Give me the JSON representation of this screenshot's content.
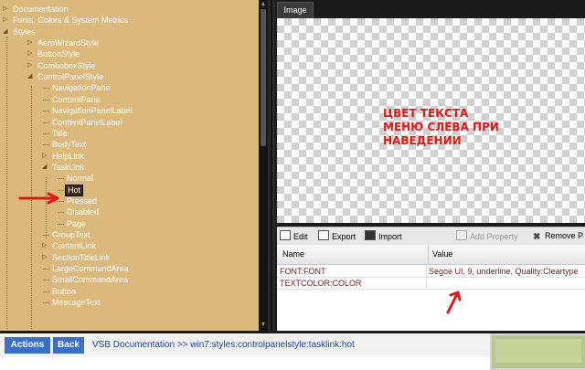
{
  "tree": {
    "items": [
      {
        "label": "Documentation",
        "level": 0,
        "expander": "collapsed"
      },
      {
        "label": "Fonts, Colors & System Metrics",
        "level": 0,
        "expander": "collapsed"
      },
      {
        "label": "Styles",
        "level": 0,
        "expander": "expanded"
      },
      {
        "label": "AeroWizardStyle",
        "level": 1,
        "expander": "collapsed"
      },
      {
        "label": "ButtonStyle",
        "level": 1,
        "expander": "collapsed"
      },
      {
        "label": "ComboboxStyle",
        "level": 1,
        "expander": "collapsed"
      },
      {
        "label": "ControlPanelStyle",
        "level": 1,
        "expander": "expanded"
      },
      {
        "label": "NavigationPane",
        "level": 2,
        "expander": "none"
      },
      {
        "label": "ContentPane",
        "level": 2,
        "expander": "none"
      },
      {
        "label": "NavigationPanelLabel",
        "level": 2,
        "expander": "none"
      },
      {
        "label": "ContentPanelLabel",
        "level": 2,
        "expander": "none"
      },
      {
        "label": "Title",
        "level": 2,
        "expander": "none"
      },
      {
        "label": "BodyText",
        "level": 2,
        "expander": "none"
      },
      {
        "label": "HelpLink",
        "level": 2,
        "expander": "collapsed"
      },
      {
        "label": "TaskLink",
        "level": 2,
        "expander": "expanded"
      },
      {
        "label": "Normal",
        "level": 3,
        "expander": "none"
      },
      {
        "label": "Hot",
        "level": 3,
        "expander": "none",
        "selected": true
      },
      {
        "label": "Pressed",
        "level": 3,
        "expander": "none"
      },
      {
        "label": "Disabled",
        "level": 3,
        "expander": "none"
      },
      {
        "label": "Page",
        "level": 3,
        "expander": "none"
      },
      {
        "label": "GroupText",
        "level": 2,
        "expander": "none"
      },
      {
        "label": "ContentLink",
        "level": 2,
        "expander": "collapsed"
      },
      {
        "label": "SectionTitleLink",
        "level": 2,
        "expander": "collapsed"
      },
      {
        "label": "LargeCommandArea",
        "level": 2,
        "expander": "none"
      },
      {
        "label": "SmallCommandArea",
        "level": 2,
        "expander": "none"
      },
      {
        "label": "Button",
        "level": 2,
        "expander": "none"
      },
      {
        "label": "MessageText",
        "level": 2,
        "expander": "none"
      }
    ]
  },
  "image_panel": {
    "tab_label": "Image",
    "annotation_lines": [
      "ЦВЕТ ТЕКСТА",
      "МЕНЮ СЛЕВА ПРИ",
      "НАВЕДЕНИИ"
    ]
  },
  "toolbar": {
    "edit_label": "Edit",
    "export_label": "Export",
    "import_label": "Import",
    "add_property_label": "Add Property",
    "remove_label": "Remove P"
  },
  "properties": {
    "columns": [
      "Name",
      "Value"
    ],
    "rows": [
      {
        "name": "FONT:FONT",
        "value": "Segoe UI, 9, underline, Quality:Cleartype"
      },
      {
        "name": "TEXTCOLOR:COLOR",
        "value": ""
      }
    ]
  },
  "bottom_bar": {
    "actions_label": "Actions",
    "back_label": "Back",
    "breadcrumb": "VSB Documentation >> win7:styles:controlpanelstyle:tasklink:hot"
  },
  "colors": {
    "tree_background": "#dbb87c",
    "annotation": "#e01818",
    "pill": "#3a6fc2",
    "breadcrumb": "#1e3fa8"
  }
}
